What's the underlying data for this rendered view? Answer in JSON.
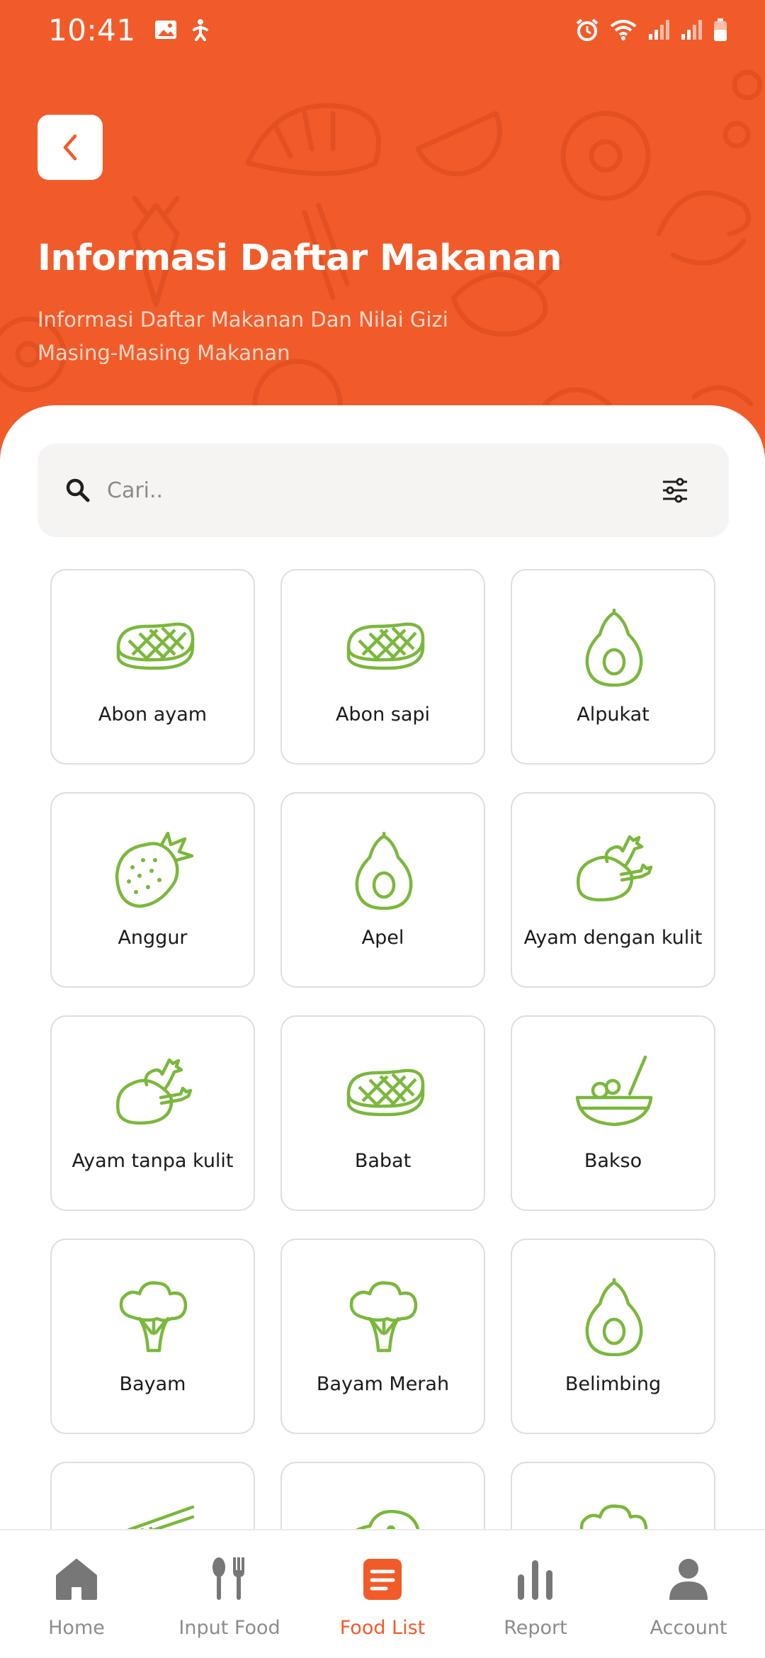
{
  "status_bar": {
    "time": "10:41",
    "left_icons": [
      "image-icon",
      "accessibility-icon"
    ],
    "right_icons": [
      "alarm-icon",
      "wifi-icon",
      "signal-icon",
      "signal-icon",
      "battery-icon"
    ]
  },
  "header": {
    "back_icon": "chevron-left-icon",
    "title": "Informasi Daftar Makanan",
    "subtitle": "Informasi Daftar Makanan Dan Nilai Gizi Masing-Masing Makanan"
  },
  "search": {
    "placeholder": "Cari..",
    "value": "",
    "search_icon": "search-icon",
    "filter_icon": "filter-sliders-icon"
  },
  "foods": [
    {
      "name": "Abon ayam",
      "icon": "steak-icon"
    },
    {
      "name": "Abon sapi",
      "icon": "steak-icon"
    },
    {
      "name": "Alpukat",
      "icon": "avocado-icon"
    },
    {
      "name": "Anggur",
      "icon": "strawberry-icon"
    },
    {
      "name": "Apel",
      "icon": "avocado-icon"
    },
    {
      "name": "Ayam dengan kulit",
      "icon": "chicken-leg-icon"
    },
    {
      "name": "Ayam tanpa kulit",
      "icon": "chicken-leg-icon"
    },
    {
      "name": "Babat",
      "icon": "steak-icon"
    },
    {
      "name": "Bakso",
      "icon": "bowl-icon"
    },
    {
      "name": "Bayam",
      "icon": "broccoli-icon"
    },
    {
      "name": "Bayam Merah",
      "icon": "broccoli-icon"
    },
    {
      "name": "Belimbing",
      "icon": "avocado-icon"
    },
    {
      "name": "",
      "icon": "noodles-icon"
    },
    {
      "name": "",
      "icon": "bread-icon"
    },
    {
      "name": "",
      "icon": "broccoli-icon"
    }
  ],
  "bottom_nav": {
    "active": "Food List",
    "items": [
      {
        "label": "Home",
        "icon": "home-icon"
      },
      {
        "label": "Input Food",
        "icon": "cutlery-icon"
      },
      {
        "label": "Food List",
        "icon": "list-icon"
      },
      {
        "label": "Report",
        "icon": "bar-chart-icon"
      },
      {
        "label": "Account",
        "icon": "user-icon"
      }
    ]
  },
  "colors": {
    "brand": "#f15b2a",
    "icon_green": "#7ab83c",
    "nav_inactive": "#8c8c8c",
    "card_border": "#dedede",
    "search_bg": "#f6f4f3"
  }
}
